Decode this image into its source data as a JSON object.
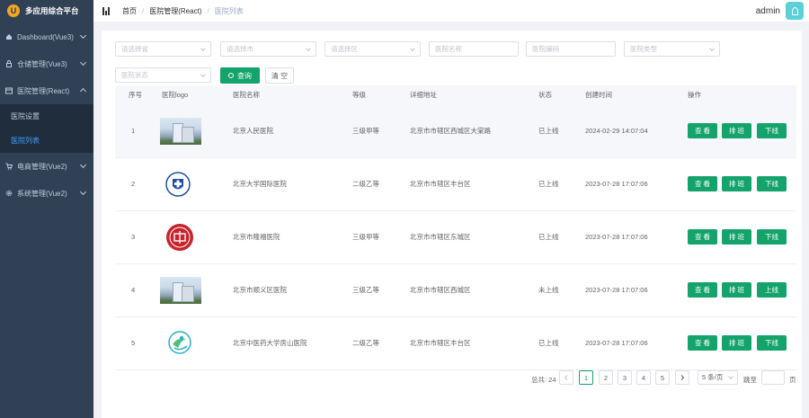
{
  "brand": {
    "title": "多应用综合平台"
  },
  "sidebar": {
    "items": [
      {
        "label": "Dashboard(Vue3)",
        "icon": "home-icon",
        "expanded": false
      },
      {
        "label": "仓储管理(Vue3)",
        "icon": "lock-icon",
        "expanded": false
      },
      {
        "label": "医院管理(React)",
        "icon": "table-icon",
        "expanded": true,
        "children": [
          {
            "label": "医院设置",
            "active": false
          },
          {
            "label": "医院列表",
            "active": true
          }
        ]
      },
      {
        "label": "电商管理(Vue2)",
        "icon": "cart-icon",
        "expanded": false
      },
      {
        "label": "系统管理(Vue2)",
        "icon": "gear-icon",
        "expanded": false
      }
    ]
  },
  "header": {
    "breadcrumbs": [
      "首页",
      "医院管理(React)",
      "医院列表"
    ],
    "user": "admin"
  },
  "filters": {
    "province": "请选择省",
    "city": "请选择市",
    "district": "请选择区",
    "hospital_name": "医院名称",
    "hospital_code": "医院编码",
    "hospital_type": "医院类型",
    "hospital_status": "医院状态",
    "query_label": "查询",
    "clear_label": "清 空"
  },
  "table": {
    "columns": [
      "序号",
      "医院logo",
      "医院名称",
      "等级",
      "详细地址",
      "状态",
      "创建时间",
      "操作"
    ],
    "rows": [
      {
        "index": "1",
        "logo": "building",
        "name": "北京人民医院",
        "level": "三级甲等",
        "address": "北京市市辖区西城区大棠路",
        "status": "已上线",
        "created": "2024-02-29 14:07:04",
        "toggle": "下线"
      },
      {
        "index": "2",
        "logo": "seal-blue",
        "name": "北京大学国际医院",
        "level": "二级乙等",
        "address": "北京市市辖区丰台区",
        "status": "已上线",
        "created": "2023-07-28 17:07:06",
        "toggle": "下线"
      },
      {
        "index": "3",
        "logo": "seal-red",
        "name": "北京市隆福医院",
        "level": "三级甲等",
        "address": "北京市市辖区东城区",
        "status": "已上线",
        "created": "2023-07-28 17:07:06",
        "toggle": "下线"
      },
      {
        "index": "4",
        "logo": "building",
        "name": "北京市顺义区医院",
        "level": "三级乙等",
        "address": "北京市市辖区西城区",
        "status": "未上线",
        "created": "2023-07-28 17:07:06",
        "toggle": "上线"
      },
      {
        "index": "5",
        "logo": "seal-teal",
        "name": "北京中医药大学房山医院",
        "level": "二级乙等",
        "address": "北京市市辖区丰台区",
        "status": "已上线",
        "created": "2023-07-28 17:07:06",
        "toggle": "下线"
      }
    ],
    "view_label": "查 看",
    "schedule_label": "排 班"
  },
  "pagination": {
    "total_label": "总共: 24",
    "pages": [
      "1",
      "2",
      "3",
      "4",
      "5"
    ],
    "current": "1",
    "page_size": "5 条/页",
    "jump_label": "跳至",
    "page_unit": "页"
  },
  "colors": {
    "primary": "#13a36b",
    "sidebar": "#304156",
    "link": "#409eff"
  }
}
